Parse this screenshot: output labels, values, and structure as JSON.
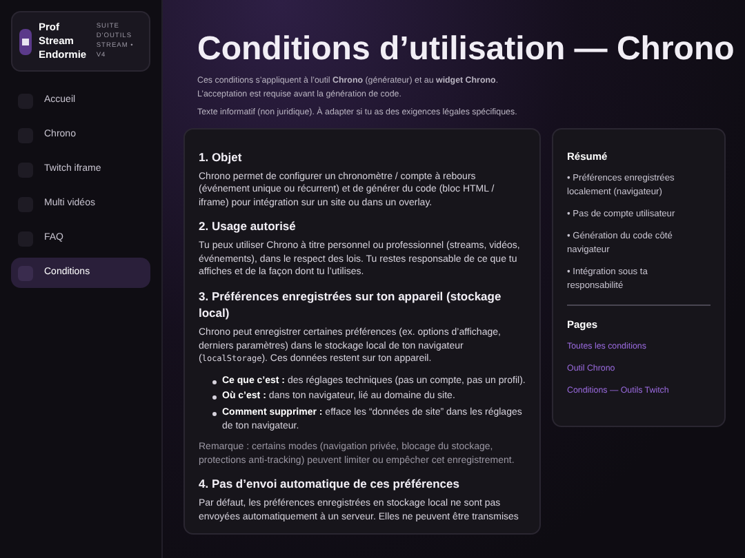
{
  "brand": {
    "name": "Prof Stream Endormie",
    "tagline": "SUITE D'OUTILS STREAM • V4"
  },
  "nav": [
    {
      "label": "Accueil",
      "selected": false
    },
    {
      "label": "Chrono",
      "selected": false
    },
    {
      "label": "Twitch iframe",
      "selected": false
    },
    {
      "label": "Multi vidéos",
      "selected": false
    },
    {
      "label": "FAQ",
      "selected": false
    },
    {
      "label": "Conditions",
      "selected": true
    }
  ],
  "page": {
    "title": "Conditions d’utilisation — Chrono",
    "intro": [
      "Ces conditions s’appliquent à l’outil **Chrono** (générateur) et au **widget Chrono**. L’acceptation est requise avant la génération de code.",
      "Texte informatif (non juridique). À adapter si tu as des exigences légales spécifiques."
    ],
    "sections": [
      {
        "heading": "1. Objet",
        "blocks": [
          {
            "kind": "paragraph",
            "segments": [
              {
                "kind": "text",
                "text": "Chrono permet de configurer un chronomètre / compte à rebours (événement unique ou récurrent) et de générer du code (bloc HTML / iframe) pour intégration sur un site ou dans un overlay."
              }
            ]
          }
        ]
      },
      {
        "heading": "2. Usage autorisé",
        "blocks": [
          {
            "kind": "paragraph",
            "segments": [
              {
                "kind": "text",
                "text": "Tu peux utiliser Chrono à titre personnel ou professionnel (streams, vidéos, événements), dans le respect des lois. Tu restes responsable de ce que tu affiches et de la façon dont tu l’utilises."
              }
            ]
          }
        ]
      },
      {
        "heading": "3. Préférences enregistrées sur ton appareil (stockage local)",
        "blocks": [
          {
            "kind": "paragraph",
            "segments": [
              {
                "kind": "text",
                "text": "Chrono peut enregistrer certaines préférences (ex. options d’affichage, derniers paramètres) dans le stockage local de ton navigateur ("
              },
              {
                "kind": "code",
                "text": "localStorage"
              },
              {
                "kind": "text",
                "text": "). Ces données restent sur ton appareil."
              }
            ]
          },
          {
            "kind": "list",
            "items": [
              "**Ce que c’est :** des réglages techniques (pas un compte, pas un profil).",
              "**Où c’est :** dans ton navigateur, lié au domaine du site.",
              "**Comment supprimer :** efface les “données de site” dans les réglages de ton navigateur."
            ]
          },
          {
            "kind": "note",
            "segments": [
              {
                "kind": "text",
                "text": "Remarque : certains modes (navigation privée, blocage du stockage, protections anti-tracking) peuvent limiter ou empêcher cet enregistrement."
              }
            ]
          }
        ]
      },
      {
        "heading": "4. Pas d’envoi automatique de ces préférences",
        "blocks": [
          {
            "kind": "paragraph",
            "segments": [
              {
                "kind": "text",
                "text": "Par défaut, les préférences enregistrées en stockage local ne sont pas envoyées automatiquement à un serveur. Elles ne peuvent être transmises"
              }
            ]
          }
        ]
      }
    ]
  },
  "summary": {
    "title": "Résumé",
    "items": [
      "• Préférences enregistrées localement (navigateur)",
      "• Pas de compte utilisateur",
      "• Génération du code côté navigateur",
      "• Intégration sous ta responsabilité"
    ],
    "pages_title": "Pages",
    "links": [
      "Toutes les conditions",
      "Outil Chrono",
      "Conditions — Outils Twitch"
    ]
  }
}
